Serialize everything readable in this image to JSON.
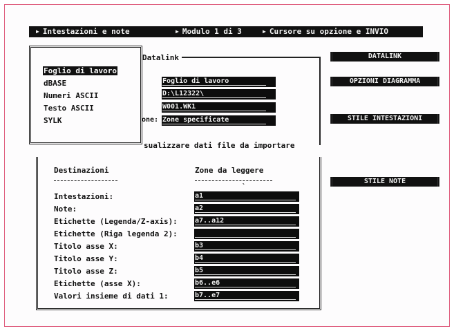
{
  "status_bar": {
    "segments": [
      {
        "label": "Intestazioni e note"
      },
      {
        "label": "Modulo 1 di 3"
      },
      {
        "label": "Cursore su opzione e INVIO"
      }
    ]
  },
  "datalink": {
    "title": "Datalink",
    "fields": {
      "source_type": "Foglio di lavoro",
      "path": "D:\\L12322\\",
      "file": "W001.WK1",
      "zone_option_label": "one:",
      "zone_option": "Zone specificate"
    },
    "visualize_label": "sualizzare dati file da importare"
  },
  "file_type_menu": {
    "items": [
      {
        "label": "Foglio di lavoro",
        "selected": true
      },
      {
        "label": "dBASE",
        "selected": false
      },
      {
        "label": "Numeri ASCII",
        "selected": false
      },
      {
        "label": "Testo ASCII",
        "selected": false
      },
      {
        "label": "SYLK",
        "selected": false
      }
    ]
  },
  "destinations": {
    "header_dest": "Destinazioni",
    "header_zones": "Zone da leggere",
    "rows": [
      {
        "label": "Intestazioni:",
        "value": "a1"
      },
      {
        "label": "Note:",
        "value": "a2"
      },
      {
        "label": "Etichette (Legenda/Z-axis):",
        "value": "a7..a12"
      },
      {
        "label": "Etichette (Riga legenda 2):",
        "value": ""
      },
      {
        "label": "Titolo asse X:",
        "value": "b3"
      },
      {
        "label": "Titolo asse Y:",
        "value": "b4"
      },
      {
        "label": "Titolo asse Z:",
        "value": "b5"
      },
      {
        "label": "Etichette (asse X):",
        "value": "b6..e6"
      },
      {
        "label": "Valori insieme di dati 1:",
        "value": "b7..e7"
      }
    ]
  },
  "right_buttons": [
    {
      "label": "DATALINK"
    },
    {
      "label": "OPZIONI DIAGRAMMA"
    },
    {
      "label": "STILE INTESTAZIONI"
    },
    {
      "label": "STILE NOTE"
    }
  ],
  "colors": {
    "frame": "#e06080",
    "field_bg": "#0d0d0d",
    "bar_bg": "#111111"
  }
}
